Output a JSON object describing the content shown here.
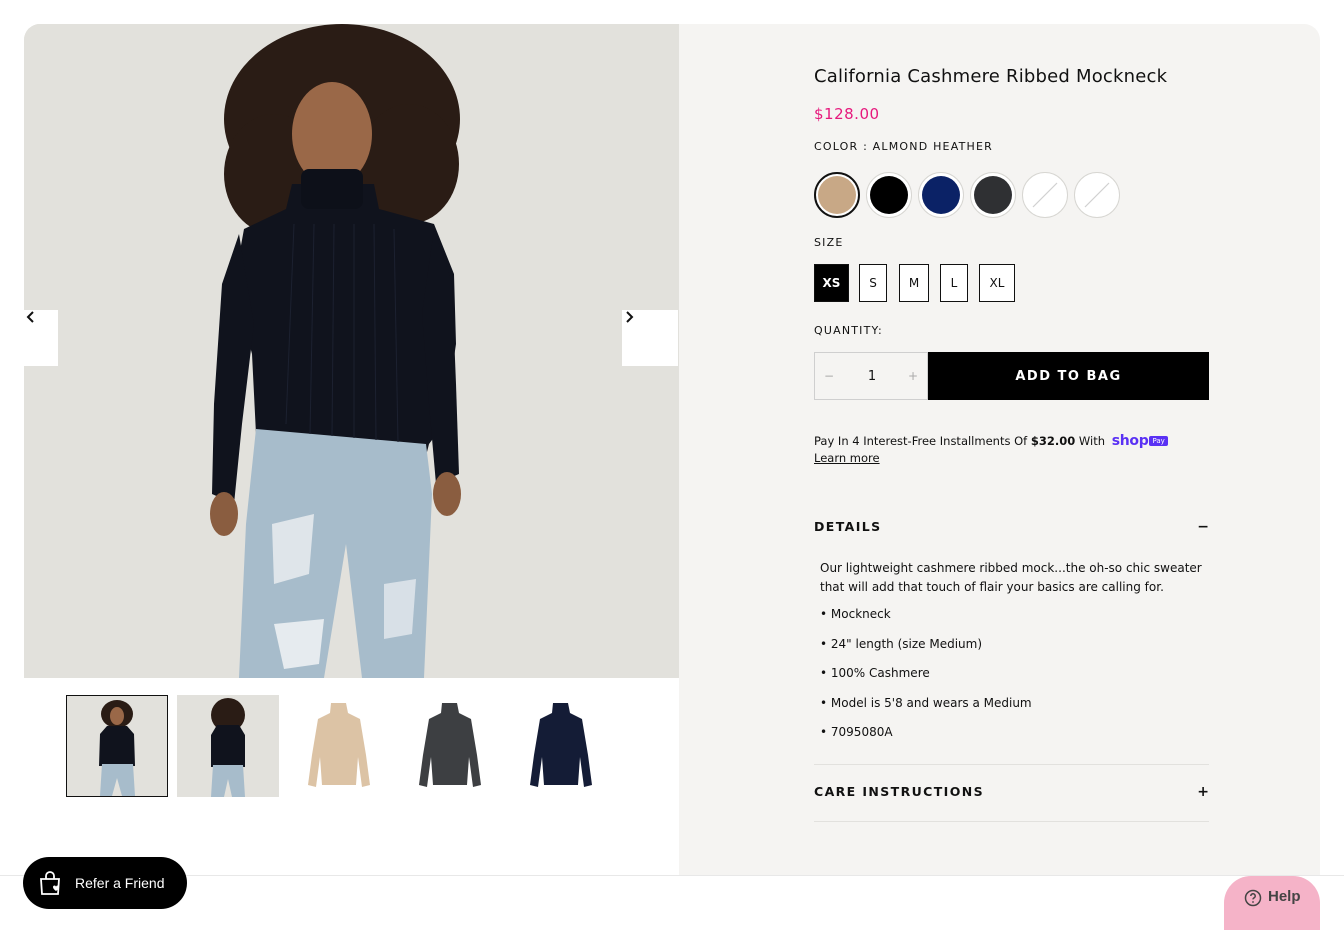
{
  "product": {
    "title": "California Cashmere Ribbed Mockneck",
    "price": "$128.00",
    "color_label": "COLOR : ALMOND HEATHER",
    "size_label": "SIZE",
    "quantity_label": "QUANTITY:"
  },
  "colors": {
    "accent_price": "#e6197d",
    "shop_pay": "#5a31f4",
    "button": "#000000",
    "panel_bg": "#f5f4f2",
    "help_bg": "#f5b3c8"
  },
  "swatches": [
    {
      "name": "Almond Heather",
      "hex": "#c8a886",
      "selected": true,
      "unavailable": false
    },
    {
      "name": "Black",
      "hex": "#000000",
      "selected": false,
      "unavailable": false
    },
    {
      "name": "Navy",
      "hex": "#0b2266",
      "selected": false,
      "unavailable": false
    },
    {
      "name": "Charcoal",
      "hex": "#2f3033",
      "selected": false,
      "unavailable": false
    },
    {
      "name": "Unavailable 1",
      "hex": "#ffffff",
      "selected": false,
      "unavailable": true
    },
    {
      "name": "Unavailable 2",
      "hex": "#ffffff",
      "selected": false,
      "unavailable": true
    }
  ],
  "sizes": [
    {
      "label": "XS",
      "selected": true
    },
    {
      "label": "S",
      "selected": false
    },
    {
      "label": "M",
      "selected": false
    },
    {
      "label": "L",
      "selected": false
    },
    {
      "label": "XL",
      "selected": false
    }
  ],
  "quantity": {
    "value": "1",
    "minus": "−",
    "plus": "+"
  },
  "add_to_bag": "ADD TO BAG",
  "installments": {
    "prefix": "Pay In 4 Interest-Free Installments Of ",
    "amount": "$32.00",
    "suffix": " With",
    "shop_logo": "shop",
    "shop_pay_badge": "Pay",
    "learn_more": "Learn more"
  },
  "details": {
    "title": "DETAILS",
    "toggle_icon": "−",
    "description": "Our lightweight cashmere ribbed mock...the oh-so chic sweater that will add that touch of flair your basics are calling for.",
    "bullets": [
      "Mockneck",
      "24\" length (size Medium)",
      "100% Cashmere",
      "Model is 5'8 and wears a Medium",
      "7095080A"
    ]
  },
  "care": {
    "title": "CARE INSTRUCTIONS",
    "toggle_icon": "+"
  },
  "gallery": {
    "prev_icon": "chevron-left-icon",
    "next_icon": "chevron-right-icon",
    "thumbnails": [
      {
        "kind": "model-front",
        "active": true
      },
      {
        "kind": "model-back",
        "active": false
      },
      {
        "kind": "flat-almond",
        "color": "#dcc3a5",
        "active": false
      },
      {
        "kind": "flat-charcoal",
        "color": "#3d3f42",
        "active": false
      },
      {
        "kind": "flat-navy",
        "color": "#141c36",
        "active": false
      }
    ]
  },
  "widgets": {
    "refer": "Refer a Friend",
    "help": "Help"
  }
}
